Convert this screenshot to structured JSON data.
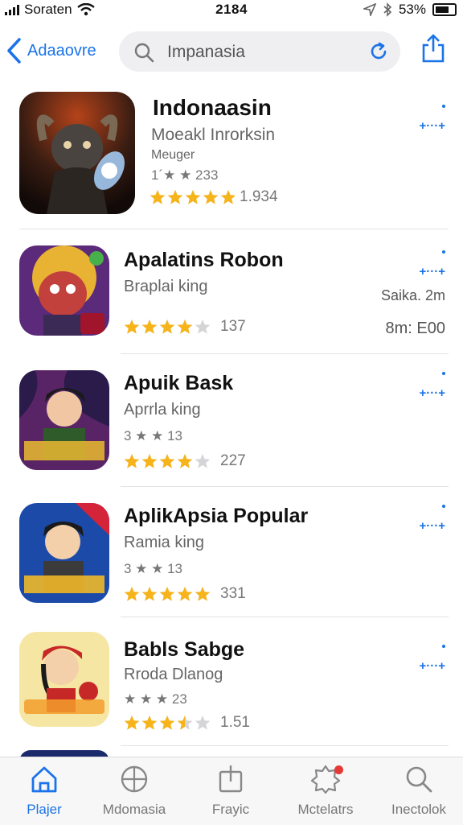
{
  "status": {
    "carrier": "Soraten",
    "time": "2184",
    "battery": "53%"
  },
  "nav": {
    "back_label": "Adaaovre",
    "search_value": "Impanasia"
  },
  "apps": [
    {
      "title": "Indonaasin",
      "subtitle": "Moeakl Inrorksin",
      "extra": "Meuger",
      "mini_rating": "1­´★ ★ 233",
      "stars": 5,
      "count": "1.934",
      "get": "+···+"
    },
    {
      "title": "Apalatins Robon",
      "subtitle": "Braplai king",
      "meta1": "Saika. 2m",
      "meta2": "8m: E00",
      "stars": 4,
      "count": "137",
      "get": "+···+"
    },
    {
      "title": "Apuik Bask",
      "subtitle": "Aprrla king",
      "mini_rating": "3 ★ ★ 13",
      "stars": 4,
      "count": "227",
      "get": "+···+"
    },
    {
      "title": "AplikApsia Popular",
      "subtitle": "Ramia king",
      "mini_rating": "3 ★ ★ 13",
      "stars": 5,
      "count": "331",
      "get": "+···+"
    },
    {
      "title": "Babls Sabge",
      "subtitle": "Rroda Dlanog",
      "mini_rating": "★ ★ ★ 23",
      "stars": 3.5,
      "count": "1.51",
      "get": "+···+"
    }
  ],
  "tabs": [
    {
      "label": "Plajer",
      "icon": "home-icon",
      "active": true
    },
    {
      "label": "Mdomasia",
      "icon": "globe-icon"
    },
    {
      "label": "Frayic",
      "icon": "share-box-icon"
    },
    {
      "label": "Mctelatrs",
      "icon": "badge-icon"
    },
    {
      "label": "Inectolok",
      "icon": "search-icon"
    }
  ],
  "colors": {
    "accent": "#1a73e8",
    "star": "#f6b41a",
    "badge": "#e53935"
  }
}
